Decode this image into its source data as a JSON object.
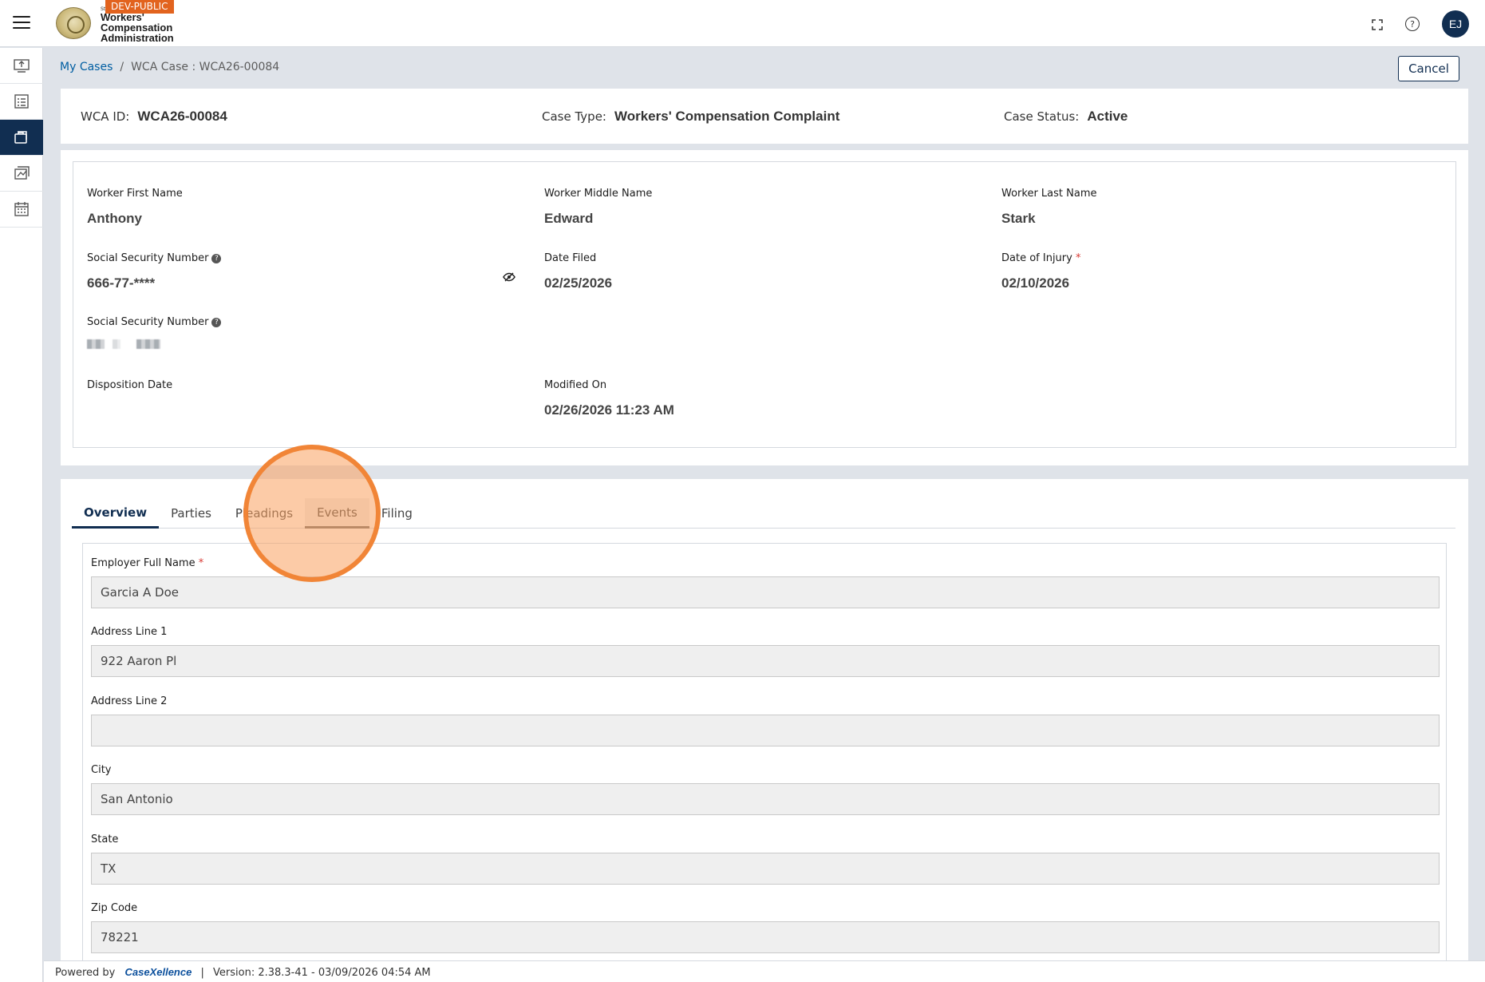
{
  "header": {
    "env_badge": "DEV-PUBLIC",
    "brand_small": "St",
    "brand_line1": "Workers'",
    "brand_line2": "Compensation",
    "brand_line3": "Administration",
    "avatar_initials": "EJ",
    "icons": [
      "menu-icon",
      "seal-logo",
      "fullscreen-icon",
      "help-icon"
    ]
  },
  "rail": {
    "icons": [
      "upload-monitor-icon",
      "checklist-icon",
      "briefcase-icon",
      "cases-icon",
      "calendar-icon"
    ],
    "active_index": 2
  },
  "breadcrumb": {
    "link": "My Cases",
    "separator": "/",
    "current": "WCA Case : WCA26-00084"
  },
  "cancel_label": "Cancel",
  "summary": {
    "wca_id_label": "WCA ID:",
    "wca_id_value": "WCA26-00084",
    "case_type_label": "Case Type:",
    "case_type_value": "Workers' Compensation Complaint",
    "case_status_label": "Case Status:",
    "case_status_value": "Active"
  },
  "details": {
    "first_name_label": "Worker First Name",
    "first_name_value": "Anthony",
    "middle_name_label": "Worker Middle Name",
    "middle_name_value": "Edward",
    "last_name_label": "Worker Last Name",
    "last_name_value": "Stark",
    "ssn_label": "Social Security Number",
    "ssn_value": "666-77-****",
    "date_filed_label": "Date Filed",
    "date_filed_value": "02/25/2026",
    "doi_label": "Date of Injury",
    "doi_required": "*",
    "doi_value": "02/10/2026",
    "ssn2_label": "Social Security Number",
    "disposition_label": "Disposition Date",
    "modified_label": "Modified On",
    "modified_value": "02/26/2026 11:23 AM"
  },
  "tabs": [
    {
      "label": "Overview"
    },
    {
      "label": "Parties"
    },
    {
      "label": "Pleadings"
    },
    {
      "label": "Events"
    },
    {
      "label": "Filing"
    }
  ],
  "overview_form": {
    "employer_label": "Employer Full Name",
    "employer_required": "*",
    "employer_value": "Garcia A Doe",
    "address1_label": "Address Line 1",
    "address1_value": "922 Aaron Pl",
    "address2_label": "Address Line 2",
    "address2_value": "",
    "city_label": "City",
    "city_value": "San Antonio",
    "state_label": "State",
    "state_value": "TX",
    "zip_label": "Zip Code",
    "zip_value": "78221"
  },
  "footer": {
    "powered_by": "Powered by",
    "brand": "CaseXellence",
    "separator": "|",
    "version": "Version: 2.38.3-41 - 03/09/2026 04:54 AM"
  },
  "colors": {
    "navy": "#112e51",
    "link": "#005ea2",
    "badge": "#e2631e",
    "required": "#d83933",
    "click_indicator": "#f0823a"
  }
}
